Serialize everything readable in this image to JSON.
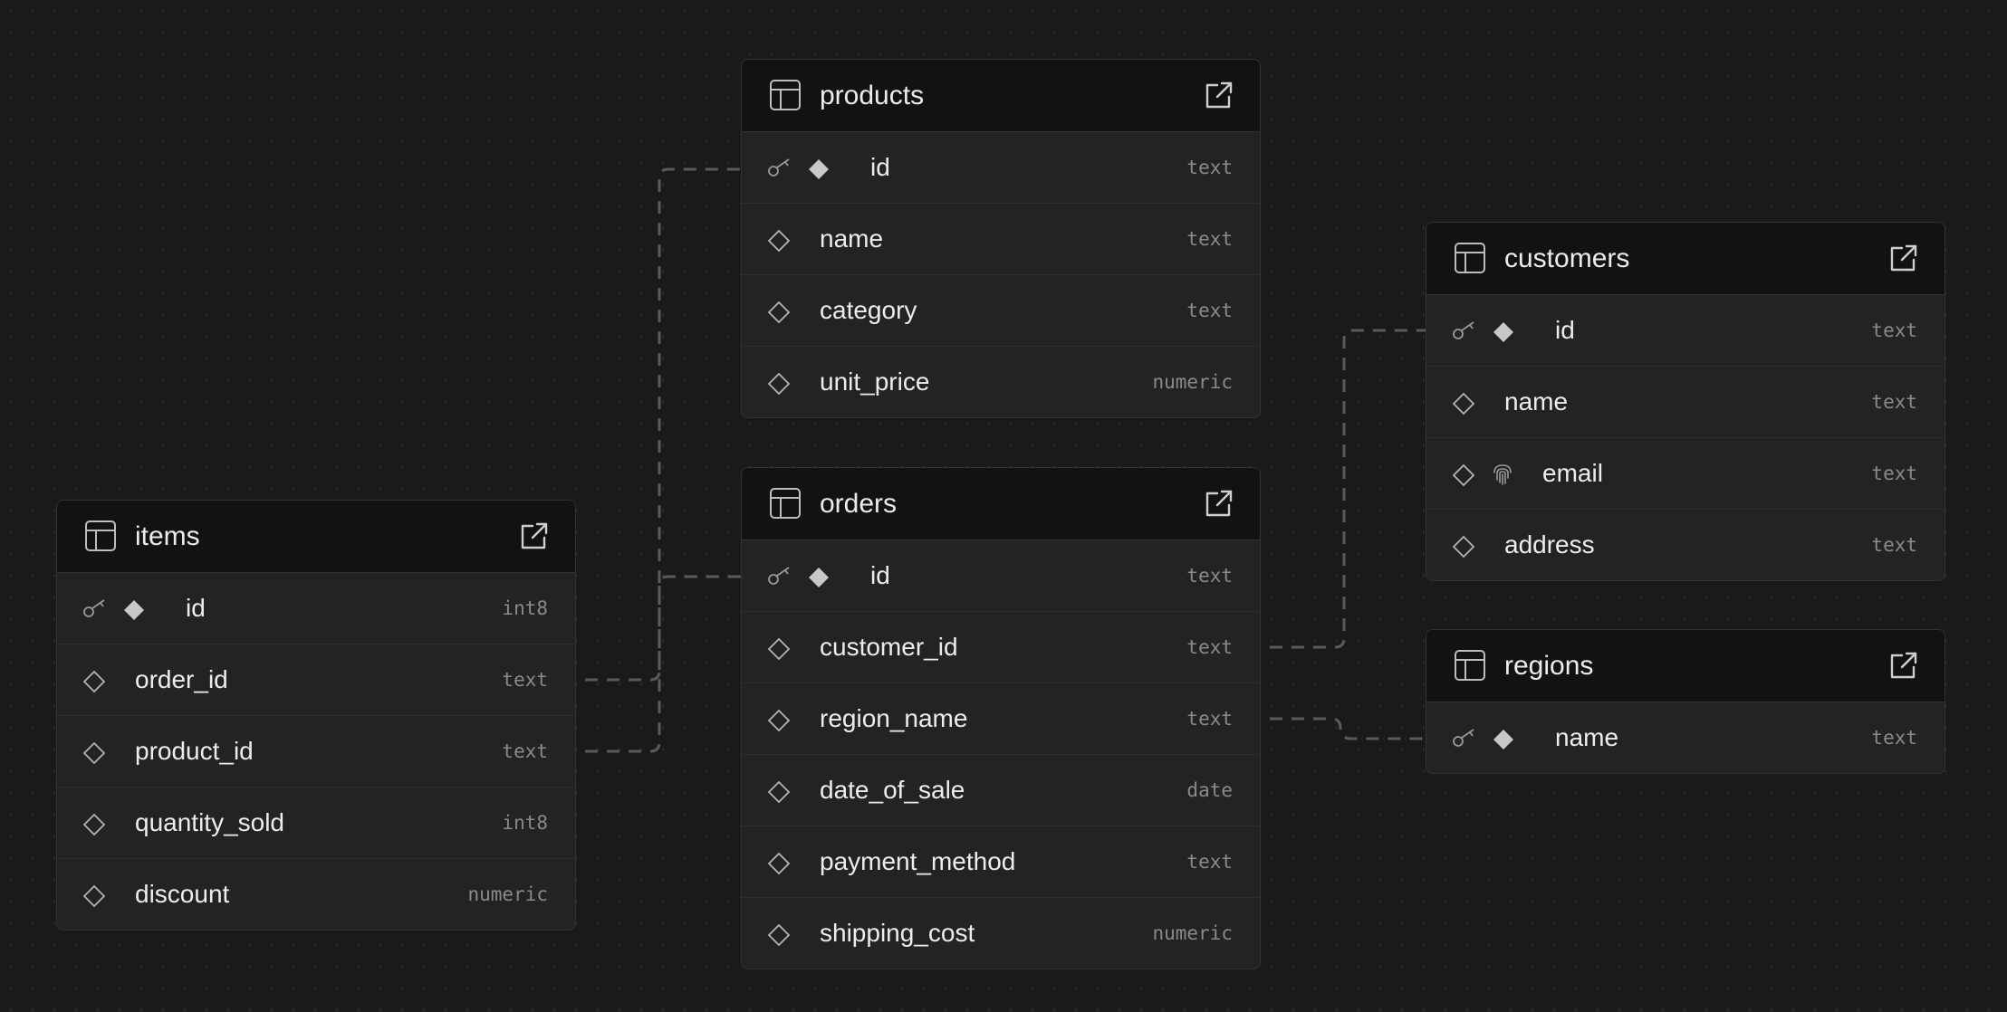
{
  "tables": {
    "products": {
      "name": "products",
      "columns": [
        {
          "name": "id",
          "type": "text",
          "primary": true
        },
        {
          "name": "name",
          "type": "text"
        },
        {
          "name": "category",
          "type": "text"
        },
        {
          "name": "unit_price",
          "type": "numeric"
        }
      ]
    },
    "orders": {
      "name": "orders",
      "columns": [
        {
          "name": "id",
          "type": "text",
          "primary": true
        },
        {
          "name": "customer_id",
          "type": "text"
        },
        {
          "name": "region_name",
          "type": "text"
        },
        {
          "name": "date_of_sale",
          "type": "date"
        },
        {
          "name": "payment_method",
          "type": "text"
        },
        {
          "name": "shipping_cost",
          "type": "numeric"
        }
      ]
    },
    "items": {
      "name": "items",
      "columns": [
        {
          "name": "id",
          "type": "int8",
          "primary": true
        },
        {
          "name": "order_id",
          "type": "text"
        },
        {
          "name": "product_id",
          "type": "text"
        },
        {
          "name": "quantity_sold",
          "type": "int8"
        },
        {
          "name": "discount",
          "type": "numeric"
        }
      ]
    },
    "customers": {
      "name": "customers",
      "columns": [
        {
          "name": "id",
          "type": "text",
          "primary": true
        },
        {
          "name": "name",
          "type": "text"
        },
        {
          "name": "email",
          "type": "text",
          "identity": true
        },
        {
          "name": "address",
          "type": "text"
        }
      ]
    },
    "regions": {
      "name": "regions",
      "columns": [
        {
          "name": "name",
          "type": "text",
          "primary": true
        }
      ]
    }
  },
  "relations": [
    {
      "from": "items.order_id",
      "to": "orders.id"
    },
    {
      "from": "items.product_id",
      "to": "products.id"
    },
    {
      "from": "orders.customer_id",
      "to": "customers.id"
    },
    {
      "from": "orders.region_name",
      "to": "regions.name"
    }
  ],
  "icons": {
    "table": "table-icon",
    "open": "external-link-icon",
    "primary_key": "key-icon",
    "column": "diamond-icon",
    "identity": "fingerprint-icon"
  },
  "colors": {
    "background": "#1a1a1a",
    "card": "#232323",
    "header": "#121212",
    "border": "#333333",
    "text": "#ededed",
    "type_text": "#8a8a8a",
    "link_line": "#5a5a5a"
  }
}
